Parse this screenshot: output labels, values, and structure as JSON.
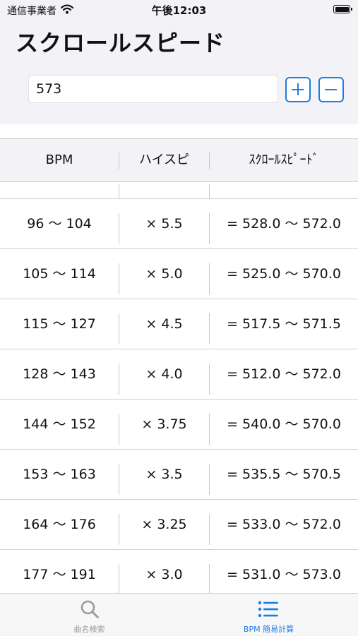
{
  "status_bar": {
    "carrier": "通信事業者",
    "time": "午後12:03"
  },
  "page_title": "スクロールスピード",
  "speed_input": {
    "value": "573"
  },
  "table": {
    "headers": [
      "BPM",
      "ハイスピ",
      "ｽｸﾛｰﾙｽﾋﾟｰﾄﾞ"
    ],
    "rows": [
      {
        "bpm": "96 〜 104",
        "hispeed": "× 5.5",
        "scroll": "= 528.0 〜 572.0"
      },
      {
        "bpm": "105 〜 114",
        "hispeed": "× 5.0",
        "scroll": "= 525.0 〜 570.0"
      },
      {
        "bpm": "115 〜 127",
        "hispeed": "× 4.5",
        "scroll": "= 517.5 〜 571.5"
      },
      {
        "bpm": "128 〜 143",
        "hispeed": "× 4.0",
        "scroll": "= 512.0 〜 572.0"
      },
      {
        "bpm": "144 〜 152",
        "hispeed": "× 3.75",
        "scroll": "= 540.0 〜 570.0"
      },
      {
        "bpm": "153 〜 163",
        "hispeed": "× 3.5",
        "scroll": "= 535.5 〜 570.5"
      },
      {
        "bpm": "164 〜 176",
        "hispeed": "× 3.25",
        "scroll": "= 533.0 〜 572.0"
      },
      {
        "bpm": "177 〜 191",
        "hispeed": "× 3.0",
        "scroll": "= 531.0 〜 573.0"
      }
    ]
  },
  "tab_bar": {
    "tabs": [
      {
        "label": "曲名検索",
        "icon": "search-icon",
        "selected": false
      },
      {
        "label": "BPM 簡易計算",
        "icon": "list-icon",
        "selected": true
      }
    ]
  },
  "colors": {
    "accent": "#1a7ee6",
    "tab_inactive": "#9a9a9f",
    "background": "#f2f2f7"
  }
}
